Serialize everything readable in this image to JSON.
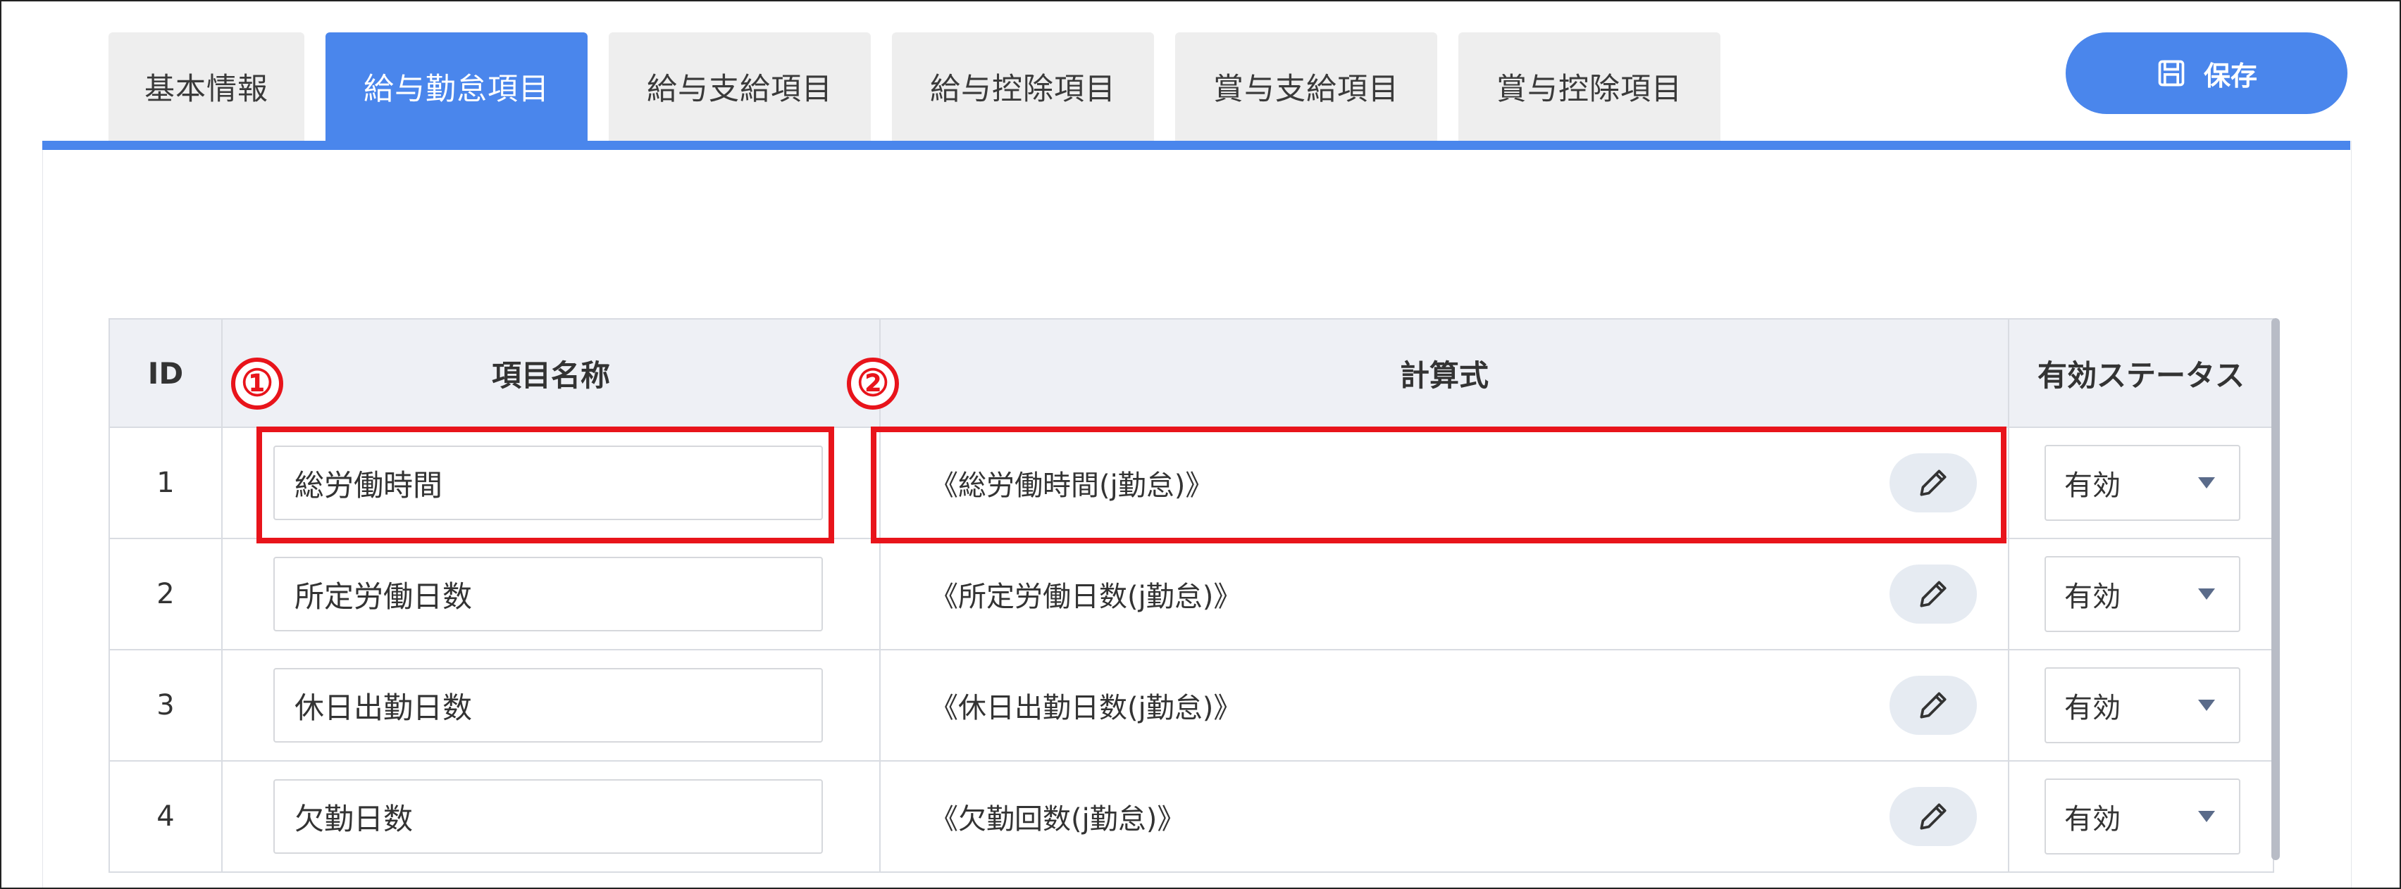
{
  "tabs": [
    {
      "label": "基本情報",
      "active": false
    },
    {
      "label": "給与勤怠項目",
      "active": true
    },
    {
      "label": "給与支給項目",
      "active": false
    },
    {
      "label": "給与控除項目",
      "active": false
    },
    {
      "label": "賞与支給項目",
      "active": false
    },
    {
      "label": "賞与控除項目",
      "active": false
    }
  ],
  "save_button": {
    "label": "保存",
    "icon": "save-icon"
  },
  "table": {
    "headers": {
      "id": "ID",
      "name": "項目名称",
      "formula": "計算式",
      "status": "有効ステータス"
    },
    "rows": [
      {
        "id": "1",
        "name": "総労働時間",
        "formula": "《総労働時間(j勤怠)》",
        "status": "有効"
      },
      {
        "id": "2",
        "name": "所定労働日数",
        "formula": "《所定労働日数(j勤怠)》",
        "status": "有効"
      },
      {
        "id": "3",
        "name": "休日出勤日数",
        "formula": "《休日出勤日数(j勤怠)》",
        "status": "有効"
      },
      {
        "id": "4",
        "name": "欠勤日数",
        "formula": "《欠勤回数(j勤怠)》",
        "status": "有効"
      }
    ]
  },
  "annotations": [
    {
      "number": "①"
    },
    {
      "number": "②"
    }
  ],
  "colors": {
    "accent": "#4a86ec",
    "highlight": "#e8141b",
    "tab_inactive": "#eeeeee",
    "header_bg": "#eef0f5"
  }
}
